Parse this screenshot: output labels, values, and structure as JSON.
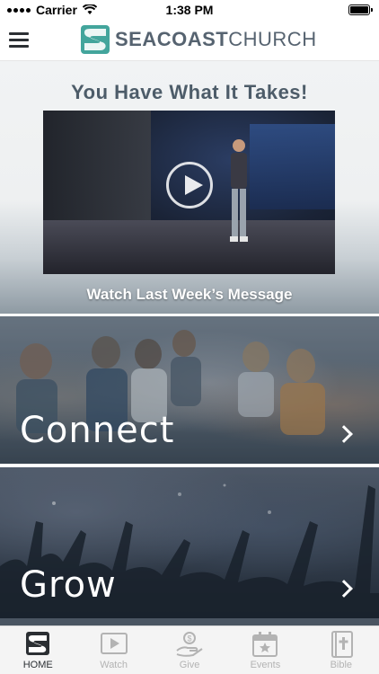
{
  "status_bar": {
    "carrier": "Carrier",
    "time": "1:38 PM"
  },
  "header": {
    "menu_icon": "hamburger-menu-icon",
    "logo_text_bold": "SEACOAST",
    "logo_text_light": "CHURCH",
    "brand_color": "#43a59c"
  },
  "hero": {
    "title": "You Have What It Takes!",
    "caption": "Watch Last Week’s Message",
    "play_icon": "play-icon",
    "title_color": "#4d5c69"
  },
  "tiles": [
    {
      "label": "Connect",
      "icon": "chevron-right-icon"
    },
    {
      "label": "Grow",
      "icon": "chevron-right-icon"
    }
  ],
  "tab_bar": {
    "tabs": [
      {
        "label": "HOME",
        "icon": "seacoast-logo-icon",
        "active": true
      },
      {
        "label": "Watch",
        "icon": "play-screen-icon",
        "active": false
      },
      {
        "label": "Give",
        "icon": "hand-coin-icon",
        "active": false
      },
      {
        "label": "Events",
        "icon": "calendar-star-icon",
        "active": false
      },
      {
        "label": "Bible",
        "icon": "bible-icon",
        "active": false
      }
    ]
  }
}
